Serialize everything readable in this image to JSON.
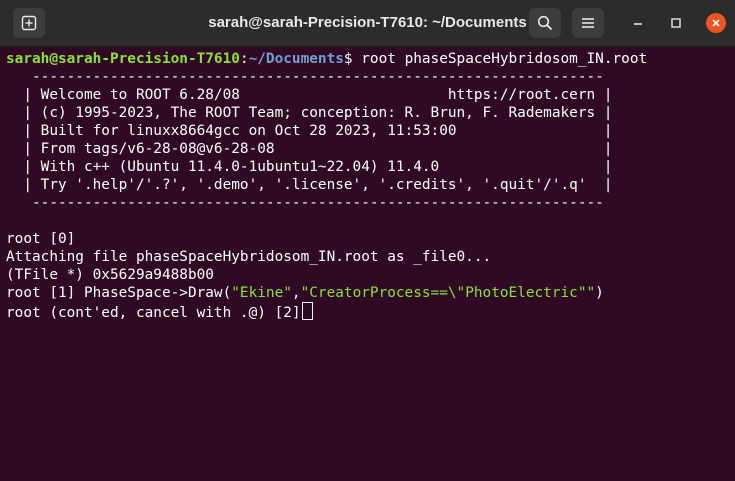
{
  "window": {
    "title": "sarah@sarah-Precision-T7610: ~/Documents",
    "buttons": {
      "new_tab_icon": "new-tab-icon",
      "search_icon": "search-icon",
      "menu_icon": "hamburger-menu-icon",
      "minimize_icon": "minimize-icon",
      "maximize_icon": "maximize-icon",
      "close_icon": "close-icon"
    },
    "colors": {
      "terminal_bg": "#300a24",
      "titlebar_bg": "#2c2c2c",
      "prompt_user": "#8ae234",
      "prompt_path": "#729fcf",
      "close_button": "#e95420"
    }
  },
  "terminal": {
    "prompt": {
      "user_host": "sarah@sarah-Precision-T7610",
      "colon": ":",
      "path": "~/Documents",
      "symbol": "$ ",
      "command": "root phaseSpaceHybridosom_IN.root"
    },
    "banner": [
      "   ------------------------------------------------------------------",
      "  | Welcome to ROOT 6.28/08                        https://root.cern |",
      "  | (c) 1995-2023, The ROOT Team; conception: R. Brun, F. Rademakers |",
      "  | Built for linuxx8664gcc on Oct 28 2023, 11:53:00                 |",
      "  | From tags/v6-28-08@v6-28-08                                      |",
      "  | With c++ (Ubuntu 11.4.0-1ubuntu1~22.04) 11.4.0                   |",
      "  | Try '.help'/'.?', '.demo', '.license', '.credits', '.quit'/'.q'  |",
      "   ------------------------------------------------------------------"
    ],
    "output": [
      "root [0]",
      "Attaching file phaseSpaceHybridosom_IN.root as _file0...",
      "(TFile *) 0x5629a9488b00"
    ],
    "draw_line": {
      "prefix": "root [1] PhaseSpace->Draw(",
      "arg1": "\"Ekine\"",
      "sep": ",",
      "arg2": "\"CreatorProcess==\\\"PhotoElectric\"\"",
      "suffix": ")"
    },
    "continuation": "root (cont'ed, cancel with .@) [2]"
  }
}
